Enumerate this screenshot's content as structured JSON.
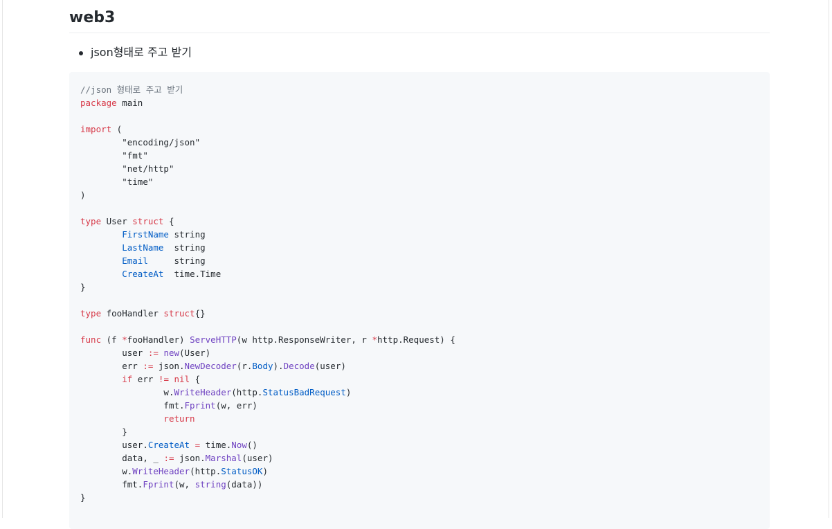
{
  "heading": "web3",
  "bullets": [
    "json형태로 주고 받기"
  ],
  "code": {
    "language": "go",
    "lines": [
      [
        {
          "t": "//json 형태로 주고 받기",
          "c": "cm"
        }
      ],
      [
        {
          "t": "package",
          "c": "kw"
        },
        {
          "t": " main"
        }
      ],
      [],
      [
        {
          "t": "import",
          "c": "kw"
        },
        {
          "t": " ("
        }
      ],
      [
        {
          "t": "\t"
        },
        {
          "t": "\"encoding/json\"",
          "c": "str"
        }
      ],
      [
        {
          "t": "\t"
        },
        {
          "t": "\"fmt\"",
          "c": "str"
        }
      ],
      [
        {
          "t": "\t"
        },
        {
          "t": "\"net/http\"",
          "c": "str"
        }
      ],
      [
        {
          "t": "\t"
        },
        {
          "t": "\"time\"",
          "c": "str"
        }
      ],
      [
        {
          "t": ")"
        }
      ],
      [],
      [
        {
          "t": "type",
          "c": "kw"
        },
        {
          "t": " User "
        },
        {
          "t": "struct",
          "c": "kw"
        },
        {
          "t": " {"
        }
      ],
      [
        {
          "t": "\t"
        },
        {
          "t": "FirstName",
          "c": "fld"
        },
        {
          "t": " string"
        }
      ],
      [
        {
          "t": "\t"
        },
        {
          "t": "LastName",
          "c": "fld"
        },
        {
          "t": "  string"
        }
      ],
      [
        {
          "t": "\t"
        },
        {
          "t": "Email",
          "c": "fld"
        },
        {
          "t": "     string"
        }
      ],
      [
        {
          "t": "\t"
        },
        {
          "t": "CreateAt",
          "c": "fld"
        },
        {
          "t": "  time.Time"
        }
      ],
      [
        {
          "t": "}"
        }
      ],
      [],
      [
        {
          "t": "type",
          "c": "kw"
        },
        {
          "t": " fooHandler "
        },
        {
          "t": "struct",
          "c": "kw"
        },
        {
          "t": "{}"
        }
      ],
      [],
      [
        {
          "t": "func",
          "c": "kw"
        },
        {
          "t": " (f "
        },
        {
          "t": "*",
          "c": "kw"
        },
        {
          "t": "fooHandler) "
        },
        {
          "t": "ServeHTTP",
          "c": "fn"
        },
        {
          "t": "(w http.ResponseWriter, r "
        },
        {
          "t": "*",
          "c": "kw"
        },
        {
          "t": "http.Request) {"
        }
      ],
      [
        {
          "t": "\tuser "
        },
        {
          "t": ":=",
          "c": "kw"
        },
        {
          "t": " "
        },
        {
          "t": "new",
          "c": "fn"
        },
        {
          "t": "(User)"
        }
      ],
      [
        {
          "t": "\terr "
        },
        {
          "t": ":=",
          "c": "kw"
        },
        {
          "t": " json."
        },
        {
          "t": "NewDecoder",
          "c": "fn"
        },
        {
          "t": "(r."
        },
        {
          "t": "Body",
          "c": "fld"
        },
        {
          "t": ")."
        },
        {
          "t": "Decode",
          "c": "fn"
        },
        {
          "t": "(user)"
        }
      ],
      [
        {
          "t": "\t"
        },
        {
          "t": "if",
          "c": "kw"
        },
        {
          "t": " err "
        },
        {
          "t": "!=",
          "c": "kw"
        },
        {
          "t": " "
        },
        {
          "t": "nil",
          "c": "kw"
        },
        {
          "t": " {"
        }
      ],
      [
        {
          "t": "\t\tw."
        },
        {
          "t": "WriteHeader",
          "c": "fn"
        },
        {
          "t": "(http."
        },
        {
          "t": "StatusBadRequest",
          "c": "fld"
        },
        {
          "t": ")"
        }
      ],
      [
        {
          "t": "\t\tfmt."
        },
        {
          "t": "Fprint",
          "c": "fn"
        },
        {
          "t": "(w, err)"
        }
      ],
      [
        {
          "t": "\t\t"
        },
        {
          "t": "return",
          "c": "kw"
        }
      ],
      [
        {
          "t": "\t}"
        }
      ],
      [
        {
          "t": "\tuser."
        },
        {
          "t": "CreateAt",
          "c": "fld"
        },
        {
          "t": " "
        },
        {
          "t": "=",
          "c": "kw"
        },
        {
          "t": " time."
        },
        {
          "t": "Now",
          "c": "fn"
        },
        {
          "t": "()"
        }
      ],
      [
        {
          "t": "\tdata, _ "
        },
        {
          "t": ":=",
          "c": "kw"
        },
        {
          "t": " json."
        },
        {
          "t": "Marshal",
          "c": "fn"
        },
        {
          "t": "(user)"
        }
      ],
      [
        {
          "t": "\tw."
        },
        {
          "t": "WriteHeader",
          "c": "fn"
        },
        {
          "t": "(http."
        },
        {
          "t": "StatusOK",
          "c": "fld"
        },
        {
          "t": ")"
        }
      ],
      [
        {
          "t": "\tfmt."
        },
        {
          "t": "Fprint",
          "c": "fn"
        },
        {
          "t": "(w, "
        },
        {
          "t": "string",
          "c": "fn"
        },
        {
          "t": "(data))"
        }
      ],
      [
        {
          "t": "}"
        }
      ]
    ]
  },
  "colors": {
    "keyword": "#d73a49",
    "field": "#005cc5",
    "function": "#6f42c1",
    "comment": "#6a737d",
    "code_background": "#f6f8fa"
  }
}
